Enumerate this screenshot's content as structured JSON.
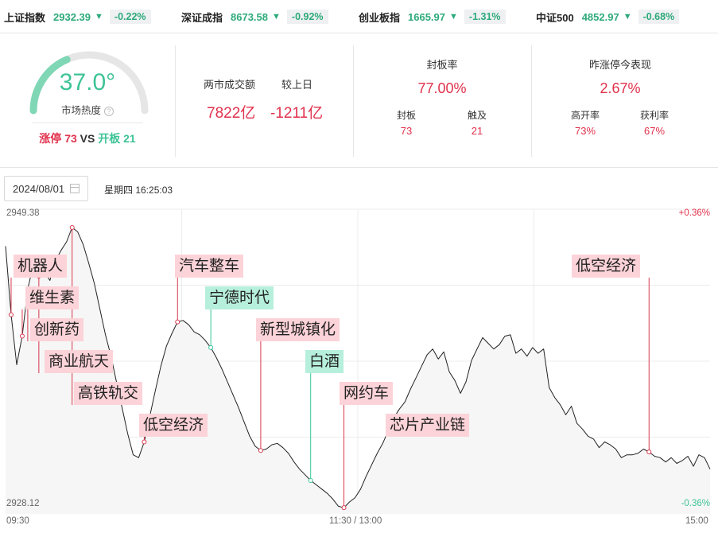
{
  "tickers": [
    {
      "name": "上证指数",
      "price": "2932.39",
      "arrow": "▼",
      "change": "-0.22%"
    },
    {
      "name": "深证成指",
      "price": "8673.58",
      "arrow": "▼",
      "change": "-0.92%"
    },
    {
      "name": "创业板指",
      "price": "1665.97",
      "arrow": "▼",
      "change": "-1.31%"
    },
    {
      "name": "中证500",
      "price": "4852.97",
      "arrow": "▼",
      "change": "-0.68%"
    }
  ],
  "heat": {
    "value": "37.0°",
    "level": 0.37,
    "label": "市场热度",
    "info_icon": "?",
    "limit_up_label": "涨停",
    "limit_up_count": "73",
    "vs": "VS",
    "opened_label": "开板",
    "opened_count": "21"
  },
  "turnover": {
    "label": "两市成交额",
    "value": "7822亿",
    "compare_label": "较上日",
    "compare_value": "-1211亿"
  },
  "seal": {
    "title": "封板率",
    "rate": "77.00%",
    "sealed_label": "封板",
    "sealed_value": "73",
    "touched_label": "触及",
    "touched_value": "21"
  },
  "yesterday": {
    "title": "昨涨停今表现",
    "value": "2.67%",
    "high_open_label": "高开率",
    "high_open_value": "73%",
    "profit_label": "获利率",
    "profit_value": "67%"
  },
  "date": {
    "value": "2024/08/01",
    "calendar_icon": "calendar-icon",
    "weekday_time": "星期四 16:25:03"
  },
  "chart_data": {
    "type": "line",
    "ylim": [
      2928.12,
      2949.38
    ],
    "ymax_label": "2949.38",
    "ymin_label": "2928.12",
    "top_pct": "+0.36%",
    "bottom_pct": "-0.36%",
    "x_labels": [
      "09:30",
      "11:30 / 13:00",
      "15:00"
    ],
    "grid": true,
    "points": [
      2946.8,
      2942.0,
      2938.5,
      2940.5,
      2943.8,
      2945.5,
      2944.7,
      2945.0,
      2944.4,
      2945.8,
      2946.5,
      2947.1,
      2948.1,
      2947.8,
      2946.9,
      2945.6,
      2944.2,
      2942.4,
      2940.6,
      2939.1,
      2937.3,
      2935.5,
      2933.7,
      2932.2,
      2932.0,
      2933.1,
      2934.9,
      2936.7,
      2938.4,
      2939.8,
      2940.7,
      2941.5,
      2941.6,
      2941.3,
      2940.8,
      2940.6,
      2940.2,
      2939.7,
      2939.0,
      2938.2,
      2937.3,
      2936.4,
      2935.5,
      2934.5,
      2933.5,
      2932.8,
      2932.5,
      2932.6,
      2932.9,
      2933.0,
      2932.7,
      2932.3,
      2931.7,
      2931.2,
      2930.8,
      2930.4,
      2930.1,
      2929.8,
      2929.5,
      2929.1,
      2928.6,
      2928.5,
      2928.9,
      2929.2,
      2929.8,
      2930.7,
      2931.5,
      2932.3,
      2933.0,
      2933.9,
      2934.8,
      2935.4,
      2935.9,
      2936.8,
      2937.6,
      2938.4,
      2939.2,
      2939.6,
      2938.9,
      2939.4,
      2938.0,
      2937.4,
      2936.5,
      2937.3,
      2938.8,
      2939.6,
      2940.4,
      2940.0,
      2939.6,
      2939.9,
      2940.5,
      2940.6,
      2939.3,
      2939.6,
      2939.1,
      2939.7,
      2939.3,
      2939.6,
      2936.9,
      2936.2,
      2935.7,
      2935.0,
      2935.6,
      2934.4,
      2934.0,
      2933.5,
      2933.3,
      2932.7,
      2933.1,
      2932.9,
      2932.6,
      2932.0,
      2932.2,
      2932.2,
      2932.3,
      2932.6,
      2932.4,
      2932.1,
      2932.0,
      2931.7,
      2932.0,
      2931.6,
      2931.8,
      2932.1,
      2931.4,
      2932.2,
      2932.0,
      2931.2
    ],
    "events": [
      {
        "label": "机器人",
        "style": "pink",
        "pt": 1
      },
      {
        "label": "维生素",
        "style": "pink",
        "pt": 3
      },
      {
        "label": "创新药",
        "style": "pink",
        "pt": 4
      },
      {
        "label": "商业航天",
        "style": "pink",
        "pt": 6
      },
      {
        "label": "高铁轨交",
        "style": "pink",
        "pt": 12
      },
      {
        "label": "低空经济",
        "style": "pink",
        "pt": 25
      },
      {
        "label": "汽车整车",
        "style": "pink",
        "pt": 31
      },
      {
        "label": "宁德时代",
        "style": "teal",
        "pt": 37
      },
      {
        "label": "新型城镇化",
        "style": "pink",
        "pt": 46
      },
      {
        "label": "白酒",
        "style": "teal",
        "pt": 55
      },
      {
        "label": "网约车",
        "style": "pink",
        "pt": 61
      },
      {
        "label": "芯片产业链",
        "style": "pink",
        "pt": 69
      },
      {
        "label": "低空经济",
        "style": "pink",
        "pt": 116
      }
    ]
  }
}
